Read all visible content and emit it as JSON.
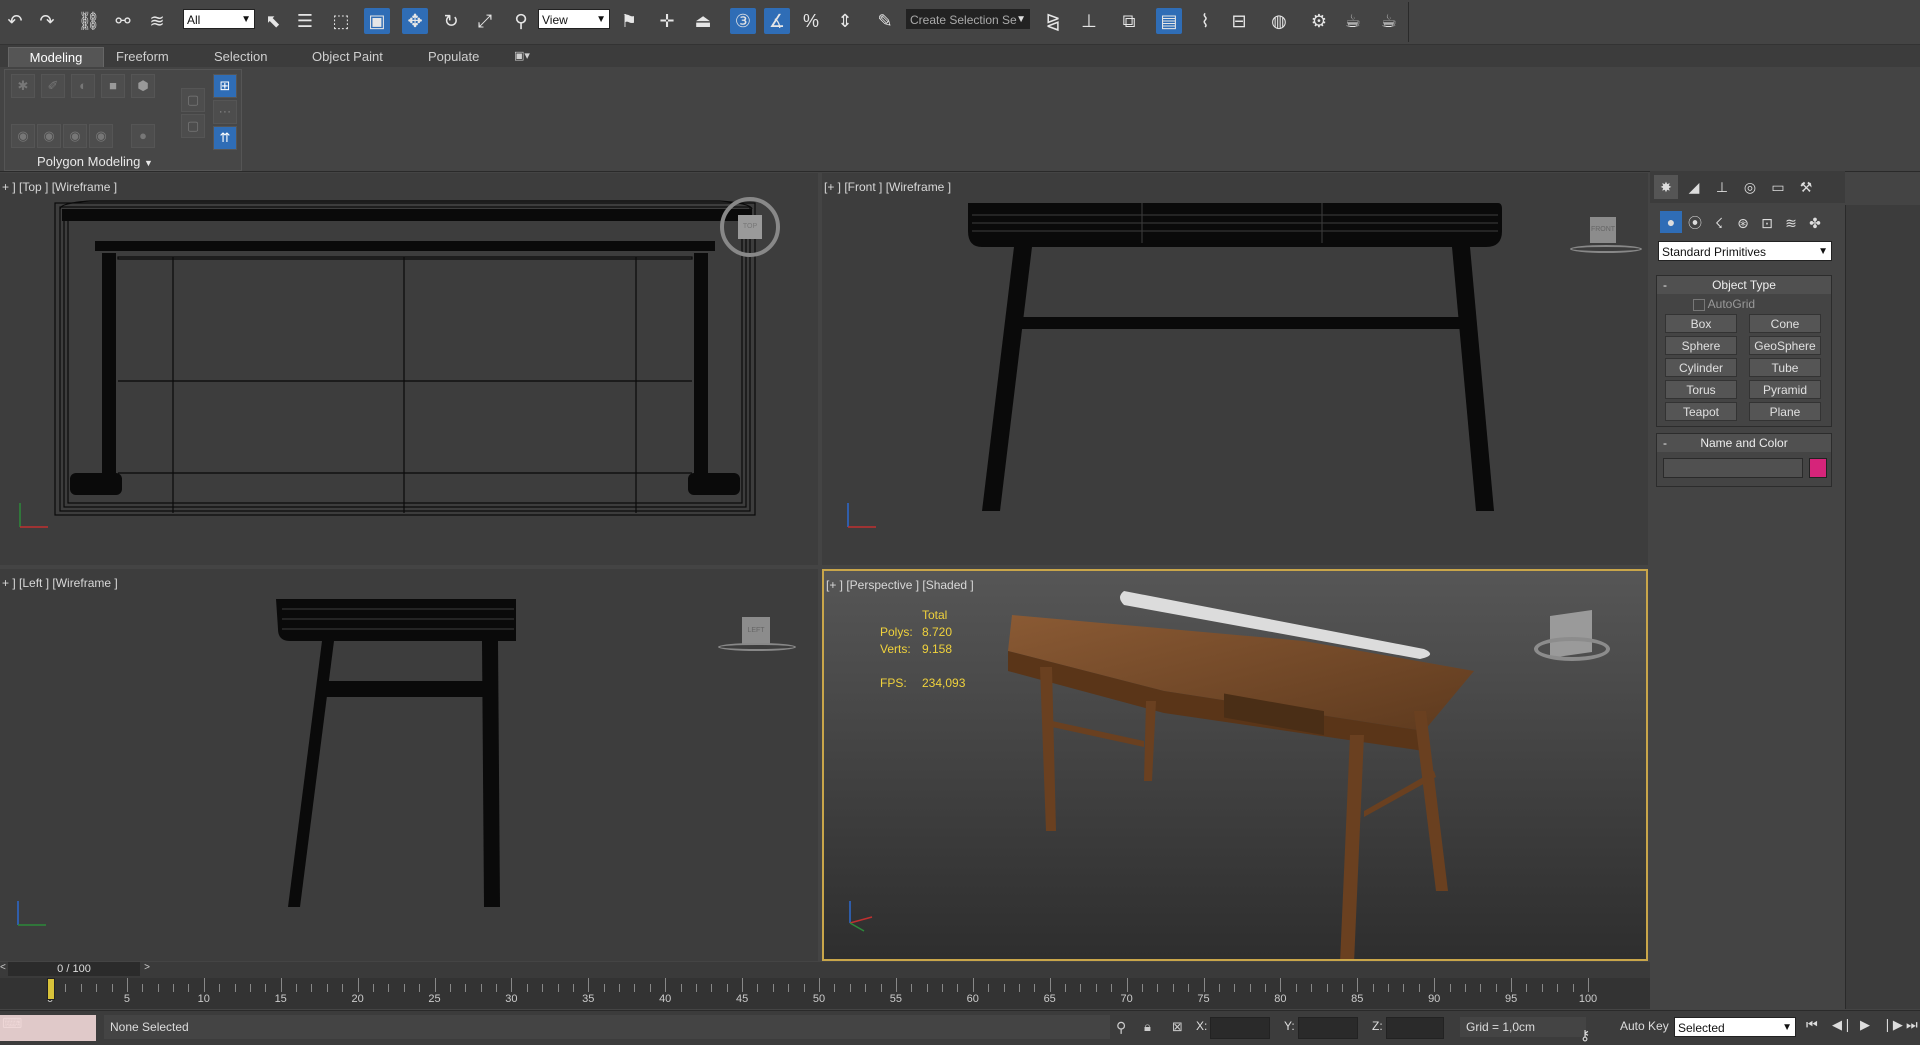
{
  "toolbar": {
    "selection_filter": "All",
    "reference_coord": "View",
    "named_selection_placeholder": "Create Selection Se"
  },
  "ribbon": {
    "tabs": [
      "Modeling",
      "Freeform",
      "Selection",
      "Object Paint",
      "Populate"
    ],
    "panel_label": "Polygon Modeling"
  },
  "viewports": {
    "top": {
      "label": "+ ] [Top ] [Wireframe ]",
      "cube": "TOP"
    },
    "front": {
      "label": "[+ ] [Front ] [Wireframe ]",
      "cube": "FRONT"
    },
    "left": {
      "label": "+ ] [Left ] [Wireframe ]",
      "cube": "LEFT"
    },
    "perspective": {
      "label": "[+ ] [Perspective ] [Shaded ]",
      "stats": {
        "total_label": "Total",
        "polys_label": "Polys:",
        "polys_value": "8.720",
        "verts_label": "Verts:",
        "verts_value": "9.158",
        "fps_label": "FPS:",
        "fps_value": "234,093"
      }
    }
  },
  "command_panel": {
    "category": "Standard Primitives",
    "object_type_title": "Object Type",
    "autogrid_label": "AutoGrid",
    "primitives": [
      "Box",
      "Cone",
      "Sphere",
      "GeoSphere",
      "Cylinder",
      "Tube",
      "Torus",
      "Pyramid",
      "Teapot",
      "Plane"
    ],
    "name_color_title": "Name and Color",
    "object_color": "#d6247a"
  },
  "timeline": {
    "frame_counter": "0 / 100",
    "next_label": ">",
    "prev_label": "<",
    "ticks": [
      "0",
      "5",
      "10",
      "15",
      "20",
      "25",
      "30",
      "35",
      "40",
      "45",
      "50",
      "55",
      "60",
      "65",
      "70",
      "75",
      "80",
      "85",
      "90",
      "95",
      "100"
    ]
  },
  "status": {
    "selection_text": "None Selected",
    "x_label": "X:",
    "y_label": "Y:",
    "z_label": "Z:",
    "grid_text": "Grid = 1,0cm",
    "autokey_label": "Auto Key",
    "key_filter": "Selected"
  },
  "colors": {
    "accent": "#2f6db6",
    "active_viewport_border": "#c9a64a",
    "stats_text": "#f0d23c"
  }
}
